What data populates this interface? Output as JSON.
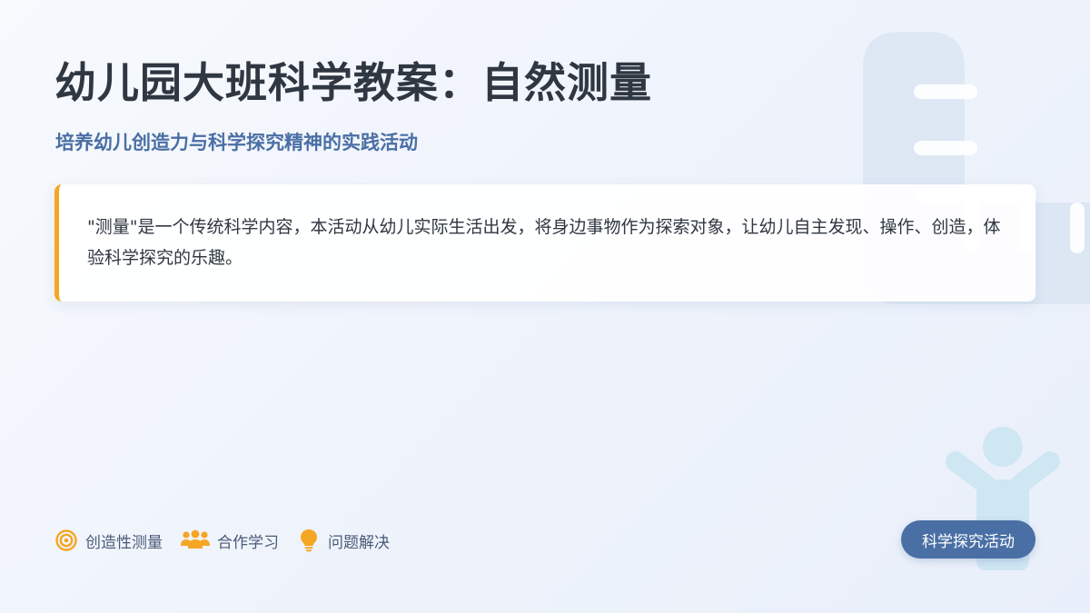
{
  "header": {
    "title": "幼儿园大班科学教案：自然测量",
    "subtitle": "培养幼儿创造力与科学探究精神的实践活动"
  },
  "intro": {
    "text": "\"测量\"是一个传统科学内容，本活动从幼儿实际生活出发，将身边事物作为探索对象，让幼儿自主发现、操作、创造，体验科学探究的乐趣。"
  },
  "tags": [
    {
      "icon": "target-icon",
      "label": "创造性测量"
    },
    {
      "icon": "group-icon",
      "label": "合作学习"
    },
    {
      "icon": "lightbulb-icon",
      "label": "问题解决"
    }
  ],
  "badge": {
    "label": "科学探究活动"
  },
  "colors": {
    "accent": "#f5a623",
    "primary": "#4a6fa5",
    "title": "#2f3742",
    "background": "#eef3fb"
  }
}
